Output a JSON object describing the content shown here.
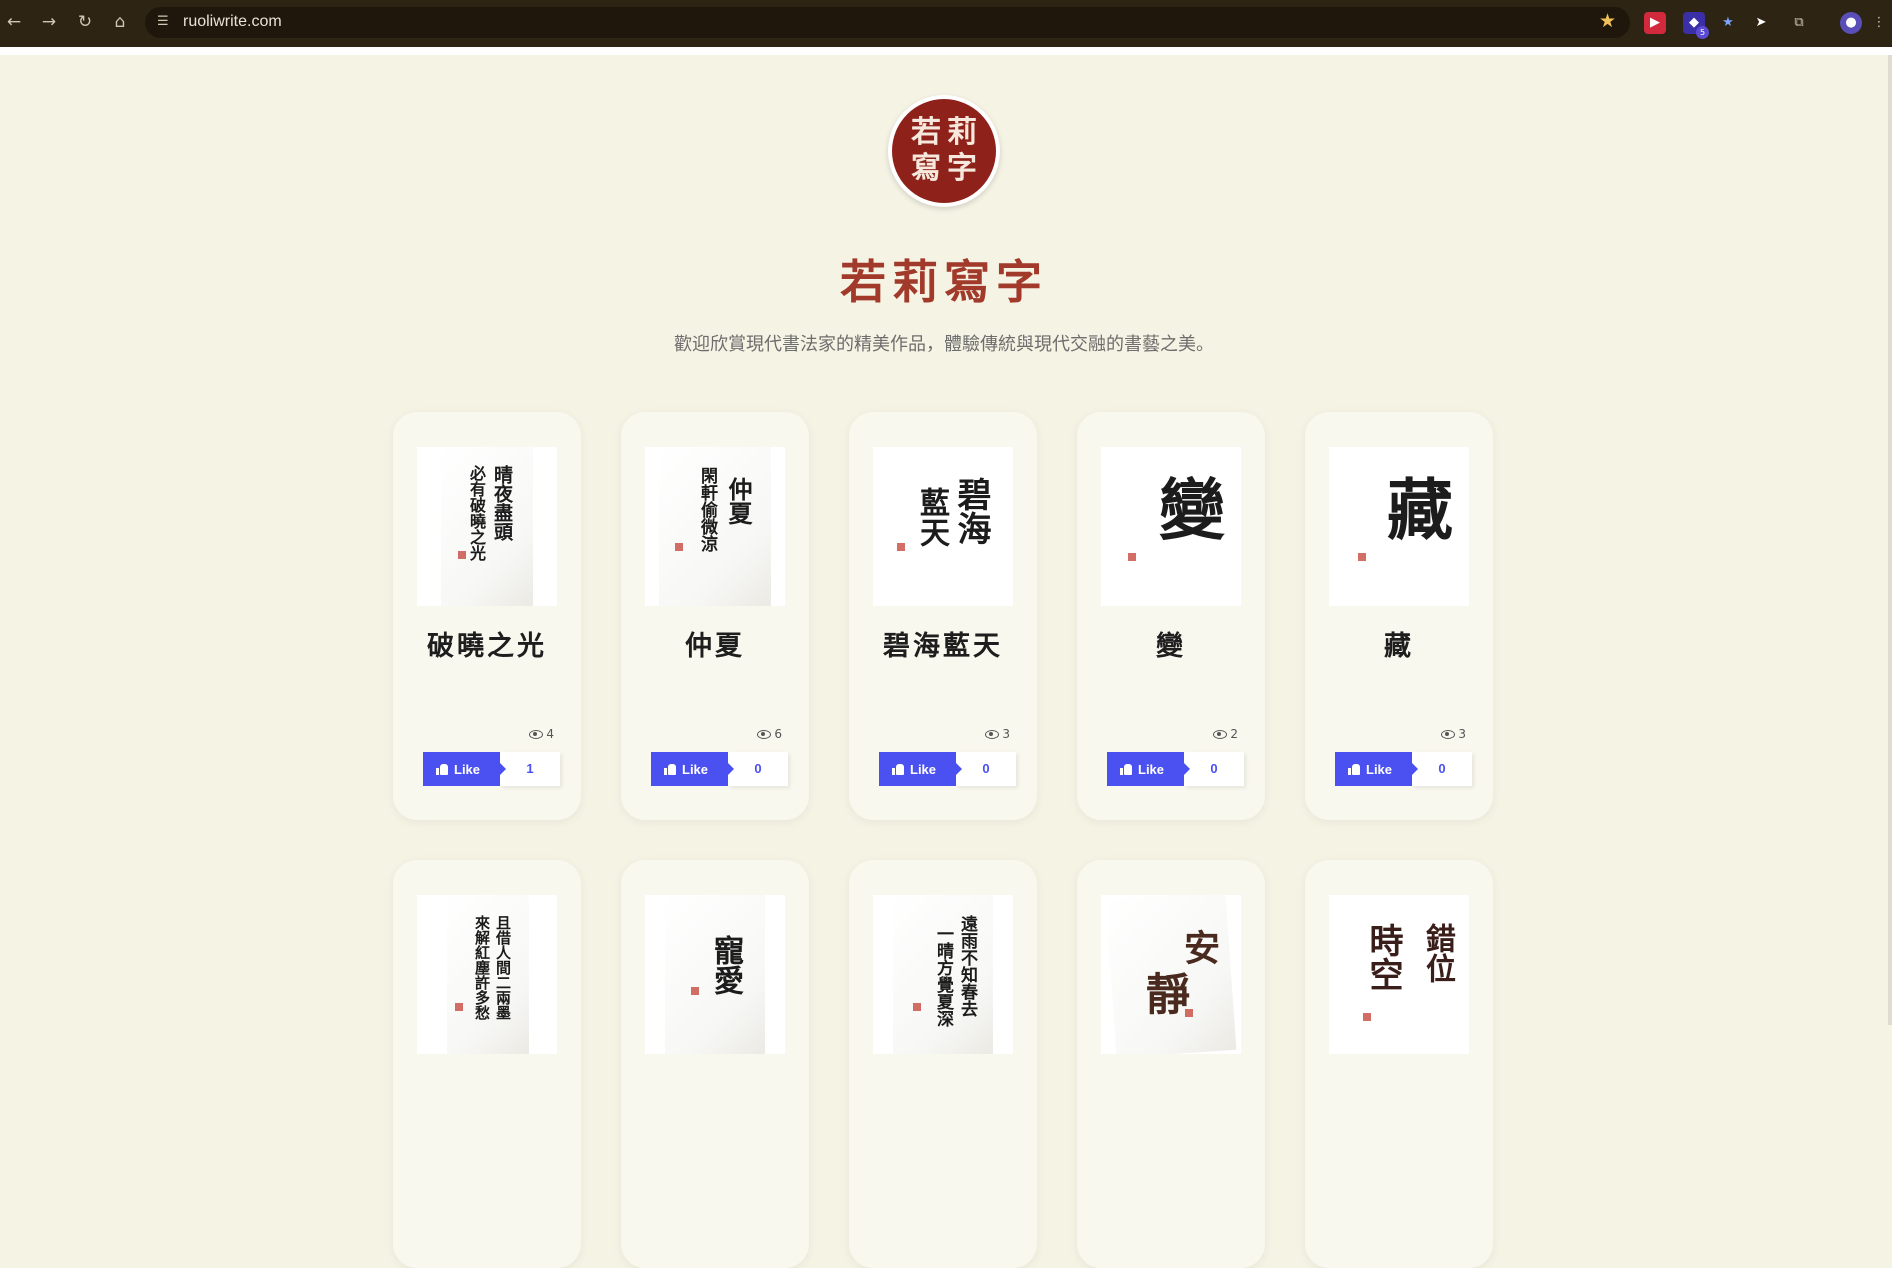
{
  "browser": {
    "url": "ruoliwrite.com",
    "extension_badge": "5"
  },
  "site": {
    "seal_chars": [
      "若",
      "莉",
      "寫",
      "字"
    ],
    "title": "若莉寫字",
    "subtitle": "歡迎欣賞現代書法家的精美作品，體驗傳統與現代交融的書藝之美。"
  },
  "artworks": [
    {
      "title": "破曉之光",
      "views": "4",
      "like_label": "Like",
      "likes": "1",
      "brush_lines": [
        "晴夜盡頭",
        "必有破曉之光"
      ]
    },
    {
      "title": "仲夏",
      "views": "6",
      "like_label": "Like",
      "likes": "0",
      "brush_lines": [
        "仲夏",
        "閑軒偷微涼"
      ]
    },
    {
      "title": "碧海藍天",
      "views": "3",
      "like_label": "Like",
      "likes": "0",
      "brush_lines": [
        "碧海",
        "藍天"
      ]
    },
    {
      "title": "變",
      "views": "2",
      "like_label": "Like",
      "likes": "0",
      "brush_lines": [
        "變"
      ]
    },
    {
      "title": "藏",
      "views": "3",
      "like_label": "Like",
      "likes": "0",
      "brush_lines": [
        "藏"
      ]
    }
  ],
  "artworks_row2": [
    {
      "brush_lines": [
        "且借人間二兩墨",
        "來解紅塵許多愁"
      ]
    },
    {
      "brush_lines": [
        "寵愛"
      ]
    },
    {
      "brush_lines": [
        "遠雨不知春去",
        "一晴方覺夏深"
      ]
    },
    {
      "brush_lines": [
        "安",
        "靜"
      ]
    },
    {
      "brush_lines": [
        "錯位",
        "時空"
      ]
    }
  ]
}
